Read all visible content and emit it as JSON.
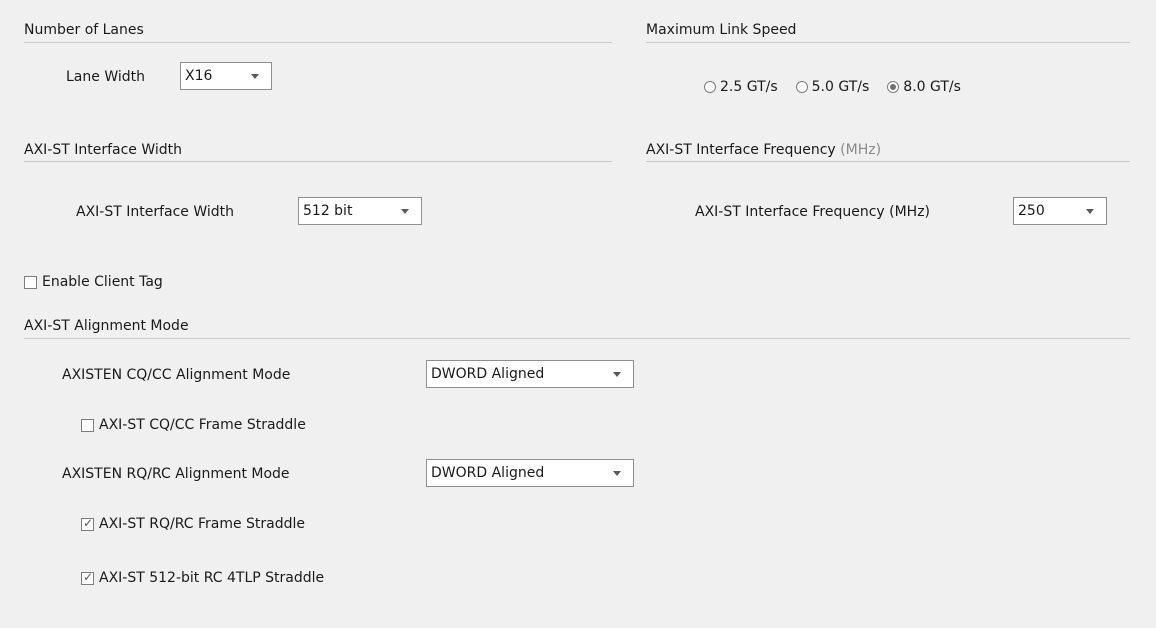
{
  "lanes": {
    "title": "Number of Lanes",
    "lane_width_label": "Lane Width",
    "lane_width_value": "X16"
  },
  "link_speed": {
    "title": "Maximum Link Speed",
    "options": [
      "2.5 GT/s",
      "5.0 GT/s",
      "8.0 GT/s"
    ],
    "selected": "8.0 GT/s"
  },
  "axi_width": {
    "title": "AXI-ST Interface Width",
    "label": "AXI-ST Interface Width",
    "value": "512 bit"
  },
  "axi_freq": {
    "title": "AXI-ST Interface Frequency",
    "title_unit": "(MHz)",
    "label": "AXI-ST Interface Frequency (MHz)",
    "value": "250"
  },
  "client_tag": {
    "label": "Enable Client Tag",
    "checked": false
  },
  "alignment": {
    "title": "AXI-ST Alignment Mode",
    "cqcc_label": "AXISTEN CQ/CC Alignment Mode",
    "cqcc_value": "DWORD Aligned",
    "cqcc_straddle_label": "AXI-ST CQ/CC Frame Straddle",
    "cqcc_straddle_checked": false,
    "rqrc_label": "AXISTEN RQ/RC Alignment Mode",
    "rqrc_value": "DWORD Aligned",
    "rqrc_straddle_label": "AXI-ST RQ/RC Frame Straddle",
    "rqrc_straddle_checked": true,
    "rc4tlp_label": "AXI-ST 512-bit RC 4TLP Straddle",
    "rc4tlp_checked": true
  }
}
